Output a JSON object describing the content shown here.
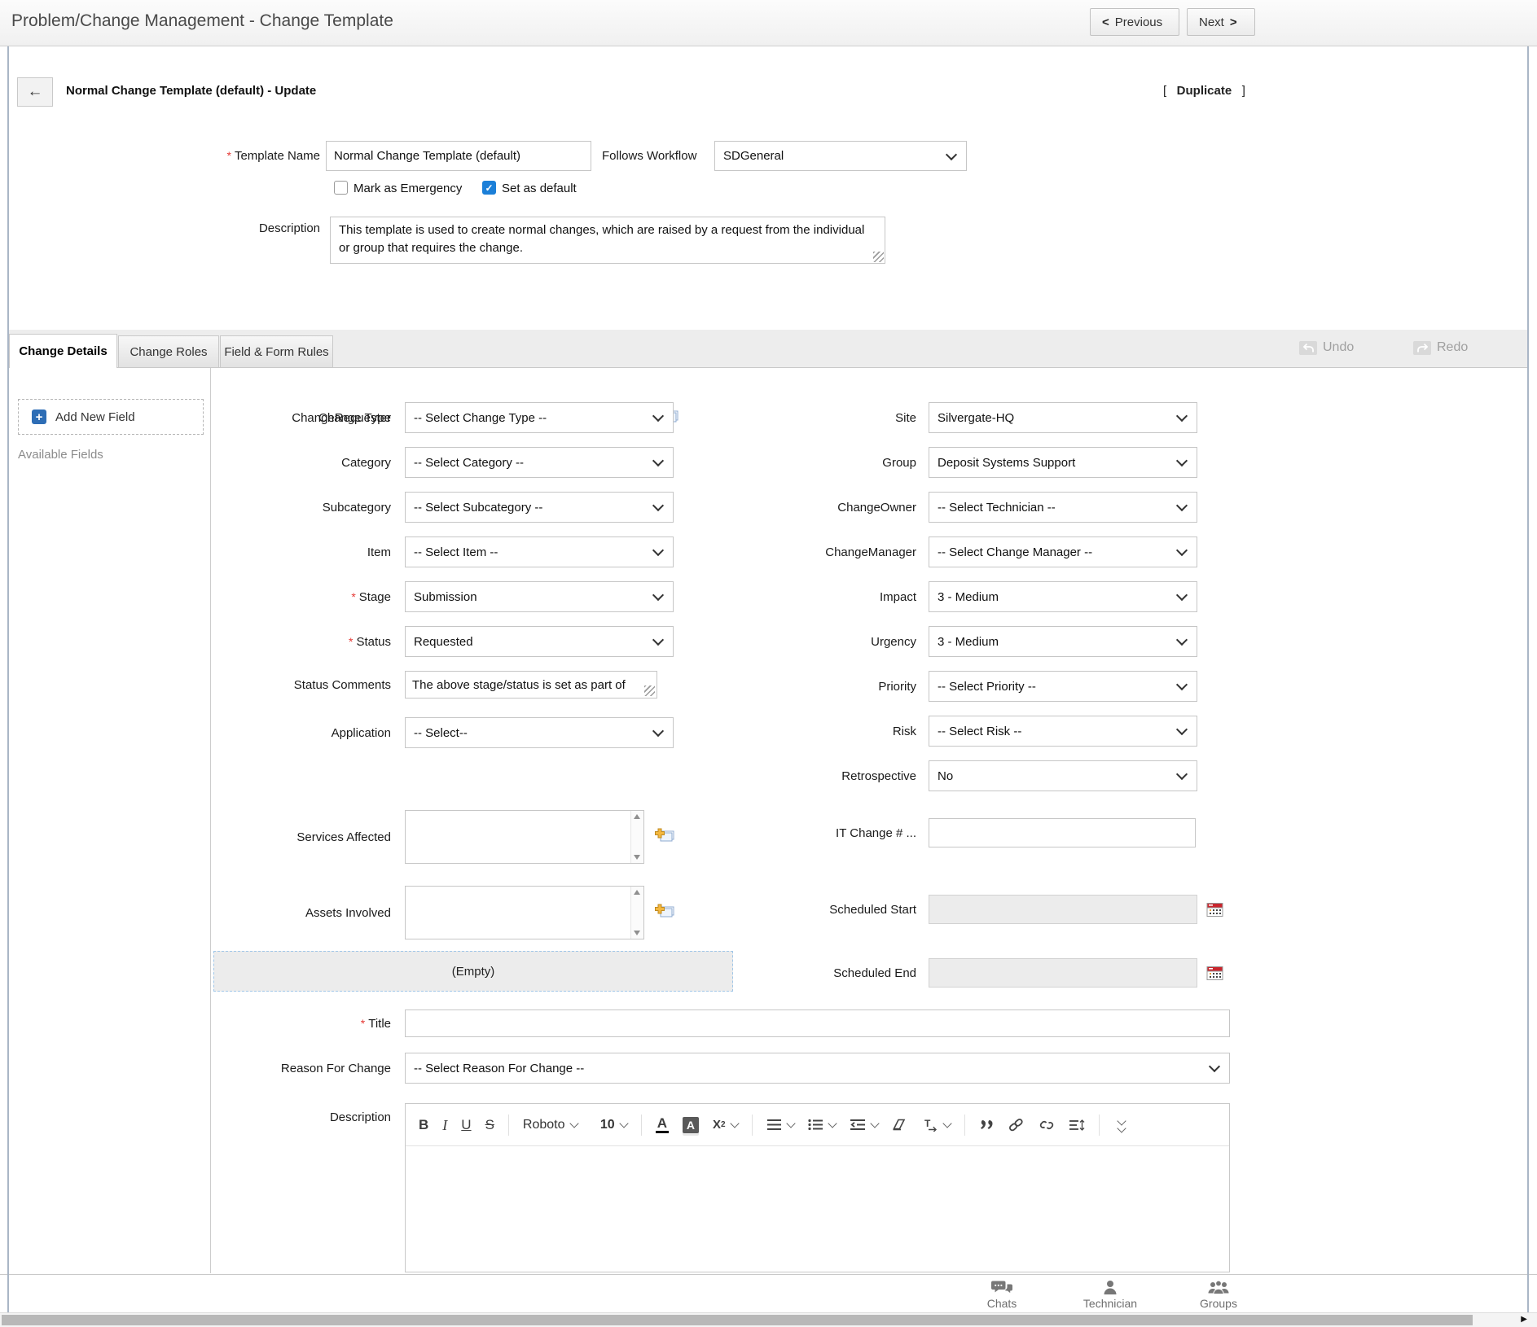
{
  "header": {
    "title": "Problem/Change Management - Change Template",
    "previous_label": "Previous",
    "next_label": "Next"
  },
  "subheader": {
    "title": "Normal Change Template (default) - Update",
    "duplicate_label": "Duplicate"
  },
  "template_form": {
    "template_name": {
      "label": "Template Name",
      "required": true,
      "value": "Normal Change Template (default)"
    },
    "follows_workflow": {
      "label": "Follows Workflow",
      "value": "SDGeneral"
    },
    "mark_as_emergency": {
      "label": "Mark as Emergency",
      "checked": false
    },
    "set_as_default": {
      "label": "Set as default",
      "checked": true
    },
    "description": {
      "label": "Description",
      "value": "This template is used to create normal changes, which are raised by a request from the individual or group that requires the change."
    }
  },
  "tabs": {
    "items": [
      {
        "label": "Change Details",
        "active": true
      },
      {
        "label": "Change Roles",
        "active": false
      },
      {
        "label": "Field & Form Rules",
        "active": false
      }
    ],
    "undo_label": "Undo",
    "redo_label": "Redo"
  },
  "sidebar": {
    "add_new_field_label": "Add New Field",
    "available_fields_label": "Available Fields"
  },
  "form": {
    "left_rows": [
      {
        "label": "ChangeRequester",
        "type": "lookup",
        "value": "",
        "icon": "select-user-icon"
      },
      {
        "label": "Change Type",
        "type": "select",
        "value": "-- Select Change Type --"
      },
      {
        "label": "Category",
        "type": "select",
        "value": "-- Select Category --"
      },
      {
        "label": "Subcategory",
        "type": "select",
        "value": "-- Select Subcategory --"
      },
      {
        "label": "Item",
        "type": "select",
        "value": "-- Select Item --"
      },
      {
        "label": "Stage",
        "type": "select",
        "value": "Submission",
        "required": true
      },
      {
        "label": "Status",
        "type": "select",
        "value": "Requested",
        "required": true
      },
      {
        "label": "Status Comments",
        "type": "textarea-line",
        "value": "The above stage/status is set as part of"
      },
      {
        "label": "Application",
        "type": "select",
        "value": "-- Select--"
      },
      {
        "label": "Services Affected",
        "type": "multibox",
        "value": "",
        "icon": "add-items-icon"
      },
      {
        "label": "Assets Involved",
        "type": "multibox",
        "value": "",
        "icon": "add-items-icon"
      }
    ],
    "right_rows": [
      {
        "label": "Site",
        "type": "select",
        "value": "Silvergate-HQ"
      },
      {
        "label": "Group",
        "type": "select",
        "value": "Deposit Systems Support"
      },
      {
        "label": "ChangeOwner",
        "type": "select",
        "value": "-- Select Technician --"
      },
      {
        "label": "ChangeManager",
        "type": "select",
        "value": "-- Select Change Manager --"
      },
      {
        "label": "Impact",
        "type": "select",
        "value": "3 - Medium"
      },
      {
        "label": "Urgency",
        "type": "select",
        "value": "3 - Medium"
      },
      {
        "label": "Priority",
        "type": "select",
        "value": "-- Select Priority --"
      },
      {
        "label": "Risk",
        "type": "select",
        "value": "-- Select Risk --"
      },
      {
        "label": "Retrospective",
        "type": "select",
        "value": "No"
      },
      {
        "label": "IT Change # ...",
        "type": "input",
        "value": ""
      },
      {
        "label": "Scheduled Start",
        "type": "datetime",
        "value": "",
        "icon": "calendar-icon"
      },
      {
        "label": "Scheduled End",
        "type": "datetime",
        "value": "",
        "icon": "calendar-icon"
      }
    ],
    "empty_placeholder": "(Empty)",
    "title_row": {
      "label": "Title",
      "required": true,
      "value": ""
    },
    "reason_row": {
      "label": "Reason For Change",
      "value": "-- Select Reason For Change --"
    },
    "description_row": {
      "label": "Description"
    }
  },
  "editor": {
    "bold": "B",
    "italic": "I",
    "underline": "U",
    "strike": "S",
    "font_name": "Roboto",
    "font_size": "10",
    "fore_color_letter": "A",
    "back_color_letter": "A",
    "superscript_letter": "X",
    "superscript_exp": "2"
  },
  "footer": {
    "chats_label": "Chats",
    "technician_label": "Technician",
    "groups_label": "Groups"
  }
}
